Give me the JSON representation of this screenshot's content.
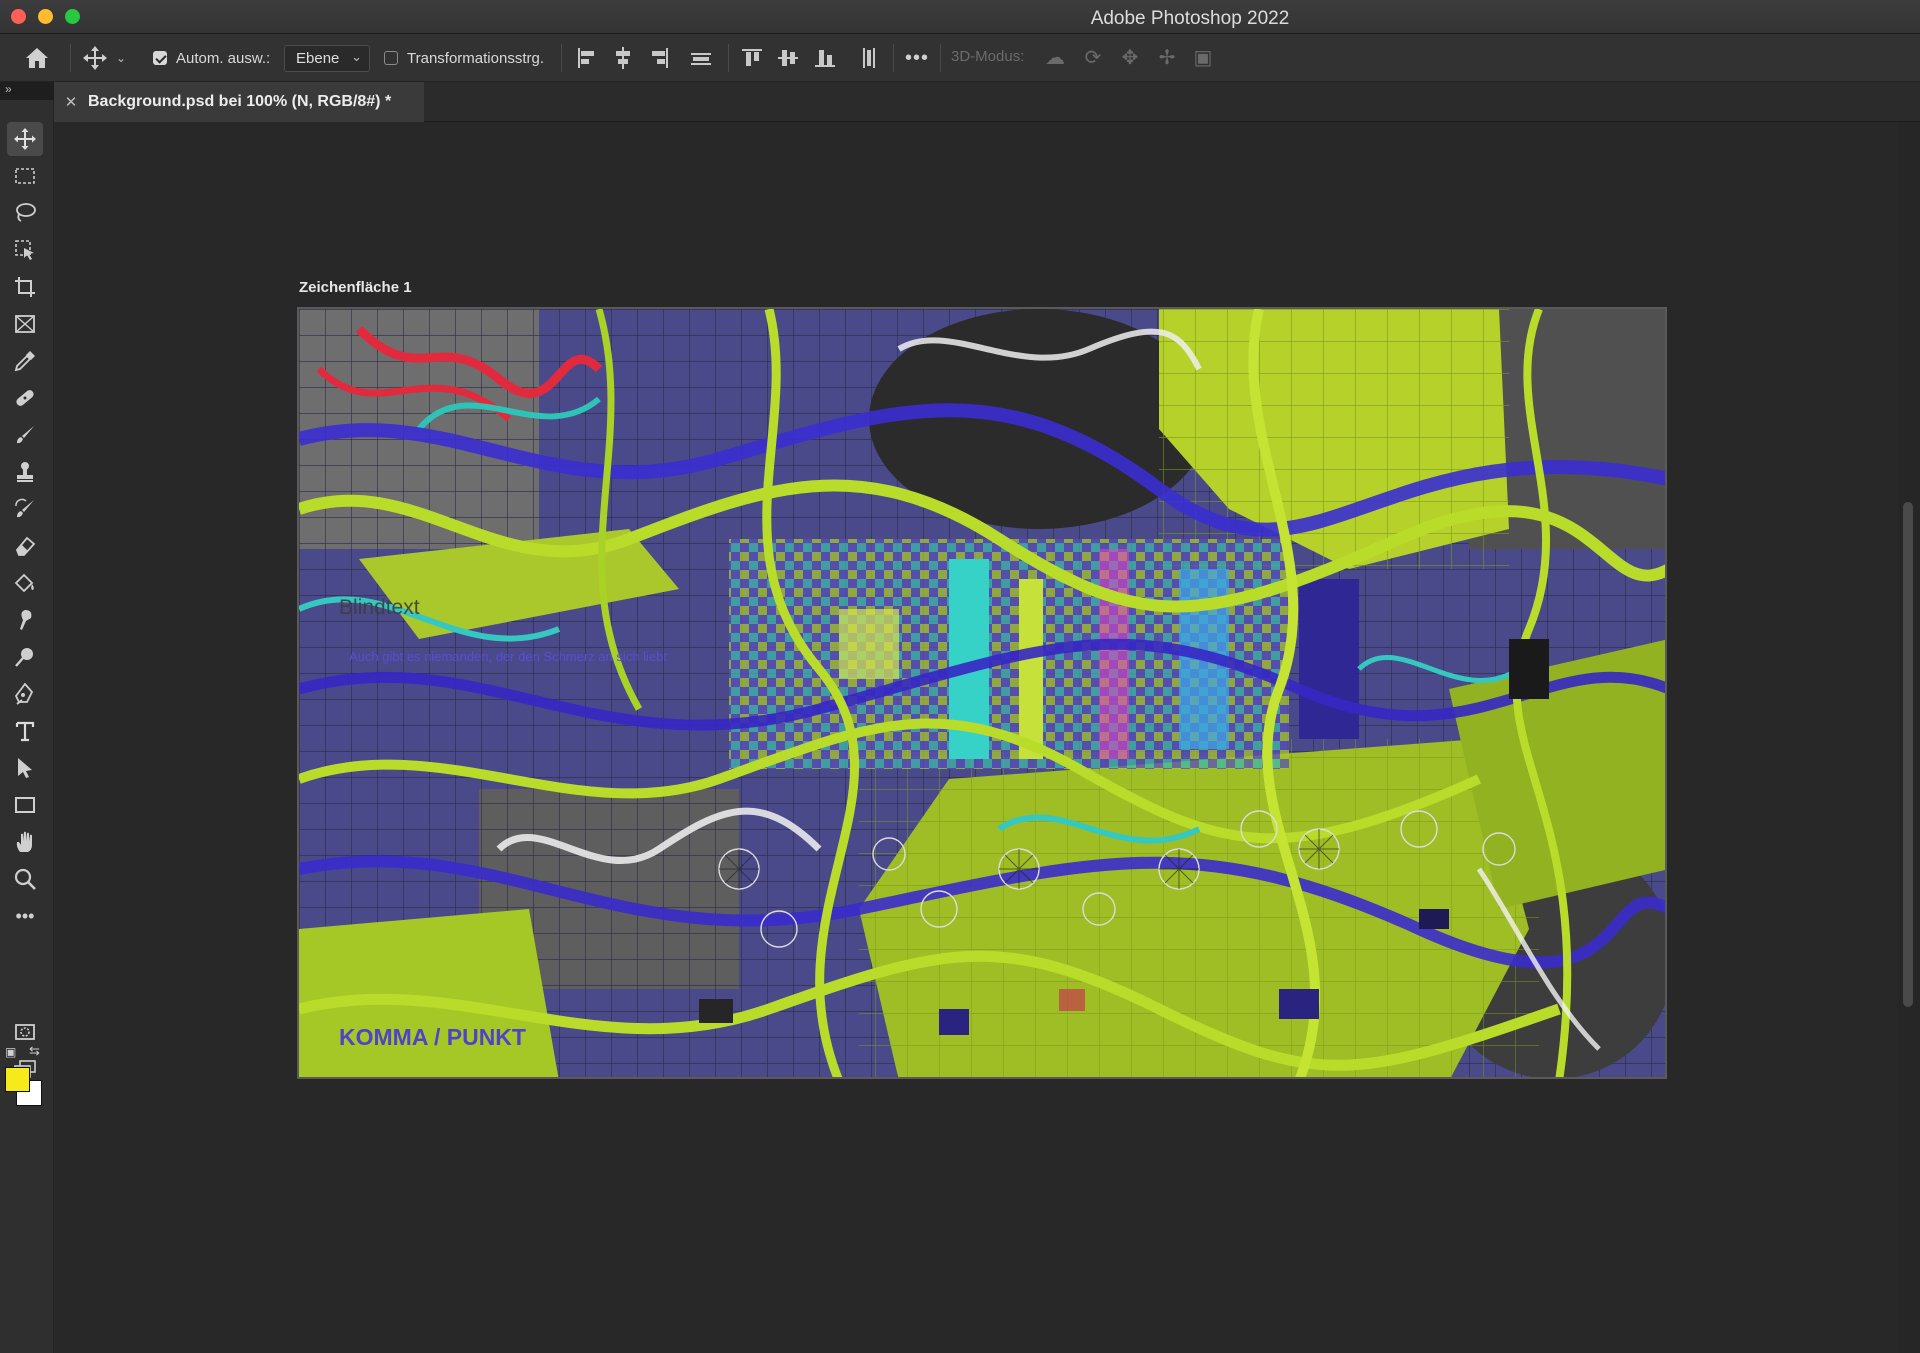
{
  "window": {
    "title": "Adobe Photoshop 2022",
    "controls": [
      "close",
      "minimize",
      "maximize"
    ]
  },
  "options_bar": {
    "home_icon": "home-icon",
    "move_tool_icon": "move-tool-icon",
    "auto_select_label": "Autom. ausw.:",
    "auto_select_checked": true,
    "auto_select_target": "Ebene",
    "transform_controls_label": "Transformationsstrg.",
    "transform_controls_checked": false,
    "mode_3d_label": "3D-Modus:",
    "align_icons": [
      "align-left-edges-icon",
      "align-horizontal-centers-icon",
      "align-right-edges-icon",
      "distribute-horizontally-icon",
      "align-top-edges-icon",
      "align-vertical-centers-icon",
      "align-bottom-edges-icon",
      "distribute-vertically-icon"
    ],
    "mode_3d_icons": [
      "orbit-3d-icon",
      "roll-3d-icon",
      "pan-3d-icon",
      "slide-3d-icon",
      "scale-3d-icon"
    ]
  },
  "document_tab": {
    "title": "Background.psd bei 100% (N, RGB/8#) *"
  },
  "artboard": {
    "label": "Zeichenfläche 1",
    "visible_text": [
      "Blindtext",
      "Auch gibt es niemanden, der den Schmerz an sich liebt",
      "KOMMA / PUNKT"
    ]
  },
  "tools": [
    "move-tool",
    "rectangular-marquee-tool",
    "lasso-tool",
    "object-selection-tool",
    "crop-tool",
    "frame-tool",
    "eyedropper-tool",
    "spot-healing-brush-tool",
    "brush-tool",
    "clone-stamp-tool",
    "history-brush-tool",
    "eraser-tool",
    "paint-bucket-tool",
    "smudge-tool",
    "dodge-tool",
    "pen-tool",
    "type-tool",
    "path-selection-tool",
    "rectangle-tool",
    "hand-tool",
    "zoom-tool",
    "edit-toolbar"
  ],
  "active_tool": "move-tool",
  "colors": {
    "foreground": "#f6ea1b",
    "background": "#ffffff",
    "accent_lime": "#b8d42a",
    "accent_violet": "#3c2fc2"
  }
}
